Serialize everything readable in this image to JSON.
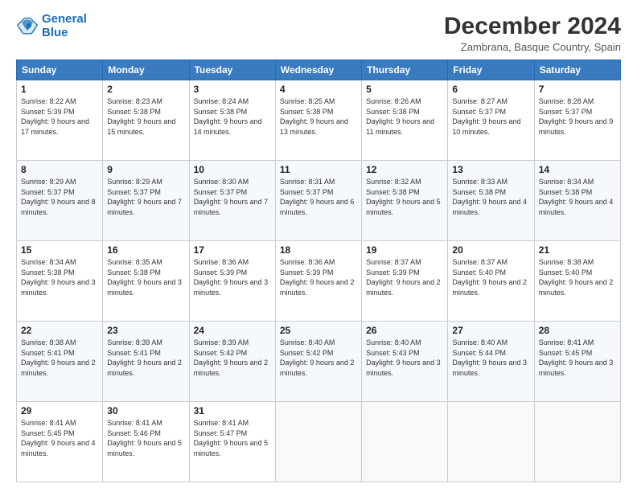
{
  "header": {
    "logo_line1": "General",
    "logo_line2": "Blue",
    "title": "December 2024",
    "subtitle": "Zambrana, Basque Country, Spain"
  },
  "days": [
    "Sunday",
    "Monday",
    "Tuesday",
    "Wednesday",
    "Thursday",
    "Friday",
    "Saturday"
  ],
  "weeks": [
    [
      {
        "day": "1",
        "sunrise": "8:22 AM",
        "sunset": "5:39 PM",
        "daylight": "9 hours and 17 minutes."
      },
      {
        "day": "2",
        "sunrise": "8:23 AM",
        "sunset": "5:38 PM",
        "daylight": "9 hours and 15 minutes."
      },
      {
        "day": "3",
        "sunrise": "8:24 AM",
        "sunset": "5:38 PM",
        "daylight": "9 hours and 14 minutes."
      },
      {
        "day": "4",
        "sunrise": "8:25 AM",
        "sunset": "5:38 PM",
        "daylight": "9 hours and 13 minutes."
      },
      {
        "day": "5",
        "sunrise": "8:26 AM",
        "sunset": "5:38 PM",
        "daylight": "9 hours and 11 minutes."
      },
      {
        "day": "6",
        "sunrise": "8:27 AM",
        "sunset": "5:37 PM",
        "daylight": "9 hours and 10 minutes."
      },
      {
        "day": "7",
        "sunrise": "8:28 AM",
        "sunset": "5:37 PM",
        "daylight": "9 hours and 9 minutes."
      }
    ],
    [
      {
        "day": "8",
        "sunrise": "8:29 AM",
        "sunset": "5:37 PM",
        "daylight": "9 hours and 8 minutes."
      },
      {
        "day": "9",
        "sunrise": "8:29 AM",
        "sunset": "5:37 PM",
        "daylight": "9 hours and 7 minutes."
      },
      {
        "day": "10",
        "sunrise": "8:30 AM",
        "sunset": "5:37 PM",
        "daylight": "9 hours and 7 minutes."
      },
      {
        "day": "11",
        "sunrise": "8:31 AM",
        "sunset": "5:37 PM",
        "daylight": "9 hours and 6 minutes."
      },
      {
        "day": "12",
        "sunrise": "8:32 AM",
        "sunset": "5:38 PM",
        "daylight": "9 hours and 5 minutes."
      },
      {
        "day": "13",
        "sunrise": "8:33 AM",
        "sunset": "5:38 PM",
        "daylight": "9 hours and 4 minutes."
      },
      {
        "day": "14",
        "sunrise": "8:34 AM",
        "sunset": "5:38 PM",
        "daylight": "9 hours and 4 minutes."
      }
    ],
    [
      {
        "day": "15",
        "sunrise": "8:34 AM",
        "sunset": "5:38 PM",
        "daylight": "9 hours and 3 minutes."
      },
      {
        "day": "16",
        "sunrise": "8:35 AM",
        "sunset": "5:38 PM",
        "daylight": "9 hours and 3 minutes."
      },
      {
        "day": "17",
        "sunrise": "8:36 AM",
        "sunset": "5:39 PM",
        "daylight": "9 hours and 3 minutes."
      },
      {
        "day": "18",
        "sunrise": "8:36 AM",
        "sunset": "5:39 PM",
        "daylight": "9 hours and 2 minutes."
      },
      {
        "day": "19",
        "sunrise": "8:37 AM",
        "sunset": "5:39 PM",
        "daylight": "9 hours and 2 minutes."
      },
      {
        "day": "20",
        "sunrise": "8:37 AM",
        "sunset": "5:40 PM",
        "daylight": "9 hours and 2 minutes."
      },
      {
        "day": "21",
        "sunrise": "8:38 AM",
        "sunset": "5:40 PM",
        "daylight": "9 hours and 2 minutes."
      }
    ],
    [
      {
        "day": "22",
        "sunrise": "8:38 AM",
        "sunset": "5:41 PM",
        "daylight": "9 hours and 2 minutes."
      },
      {
        "day": "23",
        "sunrise": "8:39 AM",
        "sunset": "5:41 PM",
        "daylight": "9 hours and 2 minutes."
      },
      {
        "day": "24",
        "sunrise": "8:39 AM",
        "sunset": "5:42 PM",
        "daylight": "9 hours and 2 minutes."
      },
      {
        "day": "25",
        "sunrise": "8:40 AM",
        "sunset": "5:42 PM",
        "daylight": "9 hours and 2 minutes."
      },
      {
        "day": "26",
        "sunrise": "8:40 AM",
        "sunset": "5:43 PM",
        "daylight": "9 hours and 3 minutes."
      },
      {
        "day": "27",
        "sunrise": "8:40 AM",
        "sunset": "5:44 PM",
        "daylight": "9 hours and 3 minutes."
      },
      {
        "day": "28",
        "sunrise": "8:41 AM",
        "sunset": "5:45 PM",
        "daylight": "9 hours and 3 minutes."
      }
    ],
    [
      {
        "day": "29",
        "sunrise": "8:41 AM",
        "sunset": "5:45 PM",
        "daylight": "9 hours and 4 minutes."
      },
      {
        "day": "30",
        "sunrise": "8:41 AM",
        "sunset": "5:46 PM",
        "daylight": "9 hours and 5 minutes."
      },
      {
        "day": "31",
        "sunrise": "8:41 AM",
        "sunset": "5:47 PM",
        "daylight": "9 hours and 5 minutes."
      },
      null,
      null,
      null,
      null
    ]
  ]
}
